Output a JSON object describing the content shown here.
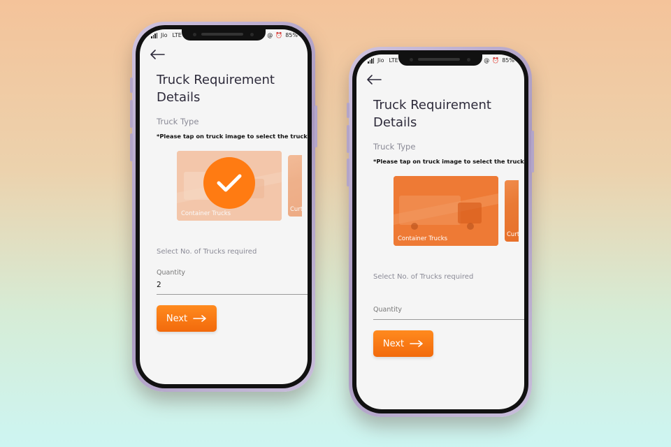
{
  "colors": {
    "accent": "#f26a0c",
    "card": "#e97a35",
    "title": "#2d2a3a"
  },
  "phones": [
    {
      "status": {
        "carrier": "Jio",
        "network": "LTE",
        "battery": "85%"
      },
      "title": "Truck Requirement Details",
      "truck_type_label": "Truck Type",
      "hint": "*Please tap on truck image to select the truck type.",
      "cards": [
        {
          "label": "Container Trucks",
          "selected": true
        },
        {
          "label": "Curt"
        }
      ],
      "trucks_required_label": "Select No. of Trucks required",
      "quantity_label": "Quantity",
      "quantity_value": "2",
      "next_label": "Next",
      "icons": {
        "back": "back-arrow-icon",
        "next": "right-arrow-icon",
        "check": "checkmark-icon"
      }
    },
    {
      "status": {
        "carrier": "Jio",
        "network": "LTE",
        "battery": "85%"
      },
      "title": "Truck Requirement Details",
      "truck_type_label": "Truck Type",
      "hint": "*Please tap on truck image to select the truck type.",
      "cards": [
        {
          "label": "Container Trucks",
          "selected": false
        },
        {
          "label": "Curt"
        }
      ],
      "trucks_required_label": "Select No. of Trucks required",
      "quantity_label": "Quantity",
      "quantity_value": "",
      "next_label": "Next",
      "icons": {
        "back": "back-arrow-icon",
        "next": "right-arrow-icon"
      }
    }
  ]
}
